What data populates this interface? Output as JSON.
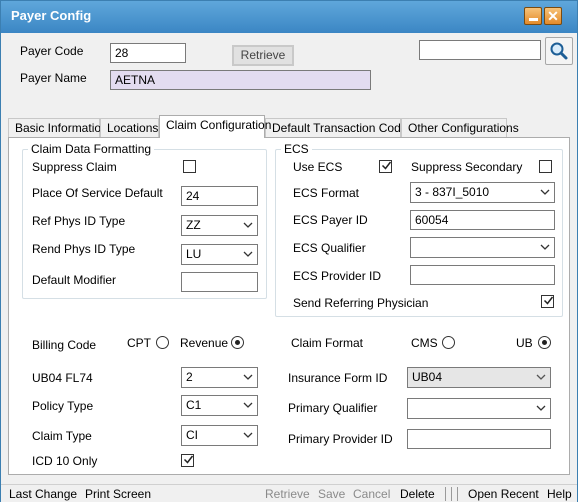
{
  "window": {
    "title": "Payer Config"
  },
  "header": {
    "payer_code_label": "Payer Code",
    "payer_code_value": "28",
    "retrieve_label": "Retrieve",
    "payer_name_label": "Payer Name",
    "payer_name_value": "AETNA",
    "search_value": ""
  },
  "tabs": [
    {
      "label": "Basic Information",
      "active": false
    },
    {
      "label": "Locations",
      "active": false
    },
    {
      "label": "Claim Configuration",
      "active": true
    },
    {
      "label": "Default Transaction Codes",
      "active": false
    },
    {
      "label": "Other Configurations",
      "active": false
    }
  ],
  "claim_data_formatting": {
    "title": "Claim Data Formatting",
    "suppress_claim_label": "Suppress Claim",
    "suppress_claim_checked": false,
    "pos_default_label": "Place Of Service Default",
    "pos_default_value": "24",
    "ref_phys_label": "Ref Phys ID Type",
    "ref_phys_value": "ZZ",
    "rend_phys_label": "Rend Phys ID Type",
    "rend_phys_value": "LU",
    "default_modifier_label": "Default Modifier",
    "default_modifier_value": ""
  },
  "ecs": {
    "title": "ECS",
    "use_ecs_label": "Use ECS",
    "use_ecs_checked": true,
    "suppress_secondary_label": "Suppress Secondary",
    "suppress_secondary_checked": false,
    "format_label": "ECS Format",
    "format_value": "3 - 837I_5010",
    "payer_id_label": "ECS Payer ID",
    "payer_id_value": "60054",
    "qualifier_label": "ECS Qualifier",
    "qualifier_value": "",
    "provider_id_label": "ECS Provider ID",
    "provider_id_value": "",
    "send_ref_label": "Send Referring Physician",
    "send_ref_checked": true
  },
  "billing": {
    "billing_code_label": "Billing Code",
    "cpt_label": "CPT",
    "revenue_label": "Revenue",
    "selected": "Revenue",
    "ub04_label": "UB04 FL74",
    "ub04_value": "2",
    "policy_type_label": "Policy Type",
    "policy_type_value": "C1",
    "claim_type_label": "Claim Type",
    "claim_type_value": "CI",
    "icd10_label": "ICD 10 Only",
    "icd10_checked": true
  },
  "claim_format": {
    "label": "Claim Format",
    "cms_label": "CMS",
    "ub_label": "UB",
    "selected": "UB",
    "insurance_form_label": "Insurance Form ID",
    "insurance_form_value": "UB04",
    "primary_qualifier_label": "Primary Qualifier",
    "primary_qualifier_value": "",
    "primary_provider_label": "Primary Provider ID",
    "primary_provider_value": ""
  },
  "statusbar": {
    "last_change": "Last Change",
    "print_screen": "Print Screen",
    "retrieve": "Retrieve",
    "save": "Save",
    "cancel": "Cancel",
    "delete": "Delete",
    "open_recent": "Open Recent",
    "help": "Help"
  },
  "colors": {
    "titlebar": "#3b86c4",
    "payer_name_bg": "#e3dcf0",
    "window_button": "#e38a2a"
  }
}
